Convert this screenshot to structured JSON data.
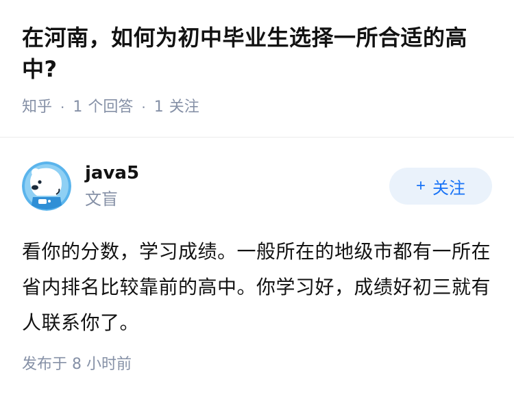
{
  "question": {
    "title": "在河南，如何为初中毕业生选择一所合适的高中?",
    "source": "知乎",
    "answers_count": "1",
    "answers_label": "个回答",
    "follow_count": "1",
    "follow_label": "关注"
  },
  "answer": {
    "author_name": "java5",
    "author_bio": "文盲",
    "avatar_icon": "polar-bear-avatar-icon",
    "follow_button_plus": "+",
    "follow_button_label": "关注",
    "content": "看你的分数，学习成绩。一般所在的地级市都有一所在省内排名比较靠前的高中。你学习好，成绩好初三就有人联系你了。",
    "published_time": "发布于 8 小时前"
  },
  "colors": {
    "primary": "#1772f6",
    "meta": "#8590a6",
    "follow_bg": "#eaf2fb"
  }
}
